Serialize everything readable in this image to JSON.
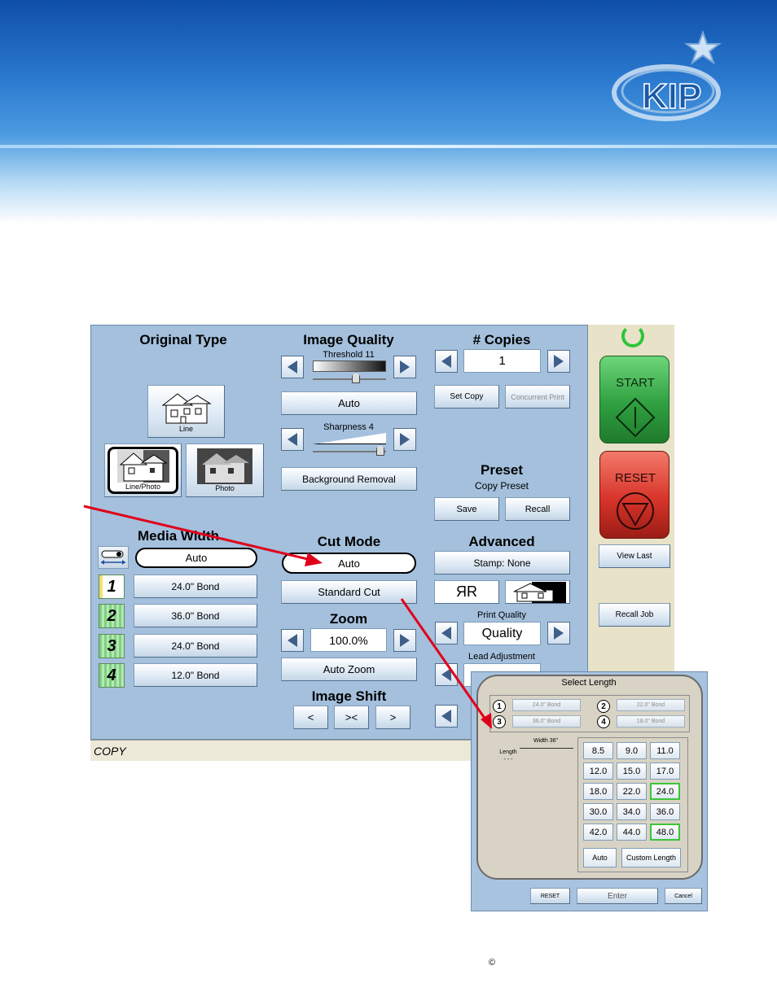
{
  "header": {
    "logo_text": "KIP"
  },
  "panel": {
    "original_type": {
      "title": "Original Type",
      "line": "Line",
      "line_photo": "Line/Photo",
      "photo": "Photo"
    },
    "image_quality": {
      "title": "Image Quality",
      "threshold": "Threshold 11",
      "auto": "Auto",
      "sharpness": "Sharpness 4",
      "background_removal": "Background Removal"
    },
    "copies": {
      "title": "# Copies",
      "value": "1",
      "set_copy": "Set Copy",
      "concurrent_print": "Concurrent Print"
    },
    "preset": {
      "title": "Preset",
      "subtitle": "Copy Preset",
      "save": "Save",
      "recall": "Recall"
    },
    "media_width": {
      "title": "Media Width",
      "auto": "Auto",
      "trays": [
        {
          "num": "1",
          "label": "24.0\" Bond"
        },
        {
          "num": "2",
          "label": "36.0\" Bond"
        },
        {
          "num": "3",
          "label": "24.0\" Bond"
        },
        {
          "num": "4",
          "label": "12.0\" Bond"
        }
      ]
    },
    "cut_mode": {
      "title": "Cut Mode",
      "auto": "Auto",
      "standard_cut": "Standard Cut"
    },
    "zoom": {
      "title": "Zoom",
      "value": "100.0%",
      "auto_zoom": "Auto Zoom"
    },
    "image_shift": {
      "title": "Image Shift",
      "left": "<",
      "center": "><",
      "right": ">"
    },
    "advanced": {
      "title": "Advanced",
      "stamp": "Stamp: None",
      "mirror": "ЯR",
      "print_quality_label": "Print Quality",
      "print_quality_value": "Quality",
      "lead_adjustment_label": "Lead Adjustment"
    }
  },
  "side": {
    "start": "START",
    "reset": "RESET",
    "view_last": "View Last",
    "recall_job": "Recall Job"
  },
  "status": {
    "mode": "COPY"
  },
  "dialog": {
    "title": "Select Length",
    "rolls": [
      {
        "num": "1",
        "label": "24.0\" Bond"
      },
      {
        "num": "2",
        "label": "22.0\" Bond"
      },
      {
        "num": "3",
        "label": "36.0\" Bond"
      },
      {
        "num": "4",
        "label": "18.0\" Bond"
      }
    ],
    "width_label": "Width 36\"",
    "length_label": "Length",
    "length_value": "- - -",
    "lengths": [
      "8.5",
      "9.0",
      "11.0",
      "12.0",
      "15.0",
      "17.0",
      "18.0",
      "22.0",
      "24.0",
      "30.0",
      "34.0",
      "36.0",
      "42.0",
      "44.0",
      "48.0"
    ],
    "auto": "Auto",
    "custom_length": "Custom Length",
    "reset": "RESET",
    "enter": "Enter",
    "cancel": "Cancel"
  },
  "footer": {
    "copyright": "©"
  },
  "colors": {
    "panel": "#a4c0dd",
    "start": "#2fa040",
    "reset": "#d8342a",
    "selected": "#3cc43c",
    "arrow": "#e0001a"
  }
}
